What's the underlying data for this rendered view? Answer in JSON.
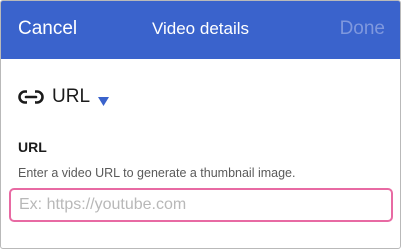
{
  "navbar": {
    "cancel_label": "Cancel",
    "title": "Video details",
    "done_label": "Done",
    "background": "#3a63cc",
    "done_color": "#7f98de"
  },
  "source_type": {
    "icon": "link-icon",
    "label": "URL",
    "dropdown_icon": "caret-down-icon",
    "accent": "#3a63cc"
  },
  "url_field": {
    "label": "URL",
    "help_text": "Enter a video URL to generate a thumbnail image.",
    "value": "",
    "placeholder": "Ex: https://youtube.com",
    "focus_border_color": "#e86aa3"
  }
}
